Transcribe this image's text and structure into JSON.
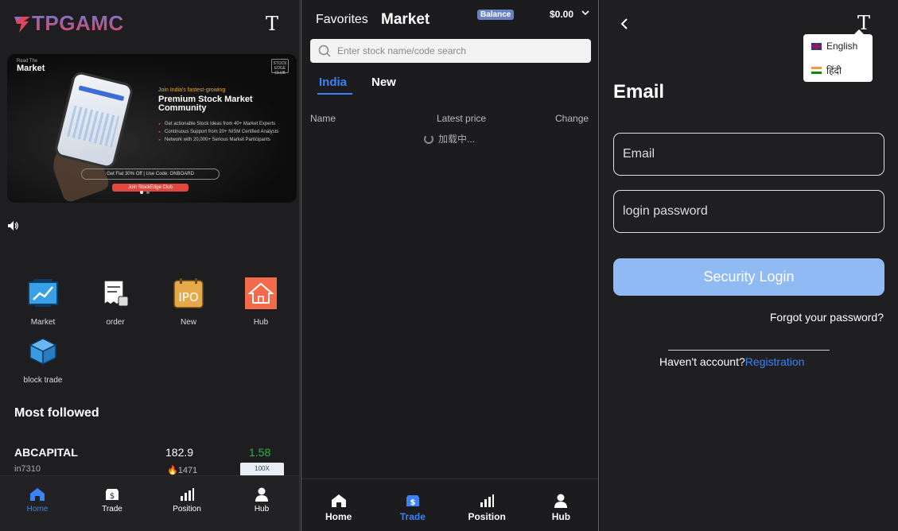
{
  "home": {
    "logo_text": "TPGAMC",
    "banner": {
      "brand": "Market",
      "brand_small": "Read The",
      "badge": "STOCK EDGE CLUB",
      "subtitle": "Join India's fastest-growing",
      "headline": "Premium Stock Market Community",
      "bullets": [
        "Get actionable Stock Ideas from 40+ Market Experts",
        "Continuous Support from 20+ NISM Certified Analysts",
        "Network with 20,000+ Serious Market Participants"
      ],
      "code_text": "Get Flat 30% Off | Use Code: ONBOARD",
      "cta": "Join StockEdge Club"
    },
    "grid": [
      {
        "label": "Market"
      },
      {
        "label": "order"
      },
      {
        "label": "New",
        "icon_text": "IPO"
      },
      {
        "label": "Hub"
      },
      {
        "label": "block trade"
      }
    ],
    "section_title": "Most followed",
    "stock": {
      "name": "ABCAPITAL",
      "code": "in7310",
      "price": "182.9",
      "volume": "1471",
      "change": "1.58",
      "badge": "100X"
    },
    "tabs": [
      "Home",
      "Trade",
      "Position",
      "Hub"
    ]
  },
  "market": {
    "favorites": "Favorites",
    "title": "Market",
    "balance_label": "Balance",
    "amount": "$0.00",
    "search_placeholder": "Enter stock name/code search",
    "tabs": [
      "India",
      "New"
    ],
    "columns": [
      "Name",
      "Latest price",
      "Change"
    ],
    "loading": "加载中...",
    "bottom_tabs": [
      "Home",
      "Trade",
      "Position",
      "Hub"
    ]
  },
  "login": {
    "languages": [
      "English",
      "हिंदी"
    ],
    "title": "Email",
    "email_placeholder": "Email",
    "password_placeholder": "login password",
    "login_button": "Security Login",
    "forgot": "Forgot your password?",
    "no_account": "Haven't account?",
    "register": "Registration"
  },
  "colors": {
    "accent": "#3b82f6",
    "login_button": "#8fbaf4",
    "positive": "#2fb34a",
    "balance_badge": "#6883c4"
  }
}
